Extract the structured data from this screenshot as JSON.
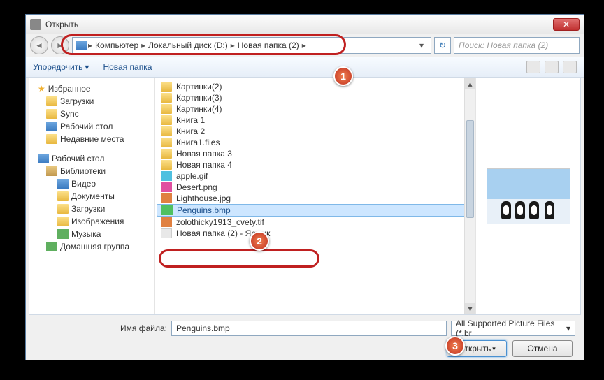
{
  "titlebar": {
    "title": "Открыть"
  },
  "breadcrumb": [
    "Компьютер",
    "Локальный диск (D:)",
    "Новая папка (2)"
  ],
  "search": {
    "placeholder": "Поиск: Новая папка (2)"
  },
  "toolbar": {
    "organize": "Упорядочить",
    "newfolder": "Новая папка"
  },
  "sidebar": {
    "favorites": {
      "label": "Избранное",
      "items": [
        "Загрузки",
        "Sync",
        "Рабочий стол",
        "Недавние места"
      ]
    },
    "desktop": {
      "label": "Рабочий стол",
      "libraries": {
        "label": "Библиотеки",
        "items": [
          "Видео",
          "Документы",
          "Загрузки",
          "Изображения",
          "Музыка"
        ]
      },
      "homegroup": "Домашняя группа"
    }
  },
  "files": [
    {
      "name": "Картинки(2)",
      "type": "folder"
    },
    {
      "name": "Картинки(3)",
      "type": "folder"
    },
    {
      "name": "Картинки(4)",
      "type": "folder"
    },
    {
      "name": "Книга 1",
      "type": "folder"
    },
    {
      "name": "Книга 2",
      "type": "folder"
    },
    {
      "name": "Книга1.files",
      "type": "folder"
    },
    {
      "name": "Новая папка 3",
      "type": "folder"
    },
    {
      "name": "Новая папка 4",
      "type": "folder"
    },
    {
      "name": "apple.gif",
      "type": "gif"
    },
    {
      "name": "Desert.png",
      "type": "png"
    },
    {
      "name": "Lighthouse.jpg",
      "type": "jpg"
    },
    {
      "name": "Penguins.bmp",
      "type": "bmp",
      "selected": true
    },
    {
      "name": "zolothicky1913_cvety.tif",
      "type": "jpg"
    },
    {
      "name": "Новая папка (2) - Ярлык",
      "type": "link"
    }
  ],
  "bottom": {
    "filenamelabel": "Имя файла:",
    "filename": "Penguins.bmp",
    "filter": "All Supported Picture Files (*.br",
    "open": "Открыть",
    "cancel": "Отмена"
  },
  "callouts": {
    "1": "1",
    "2": "2",
    "3": "3"
  }
}
